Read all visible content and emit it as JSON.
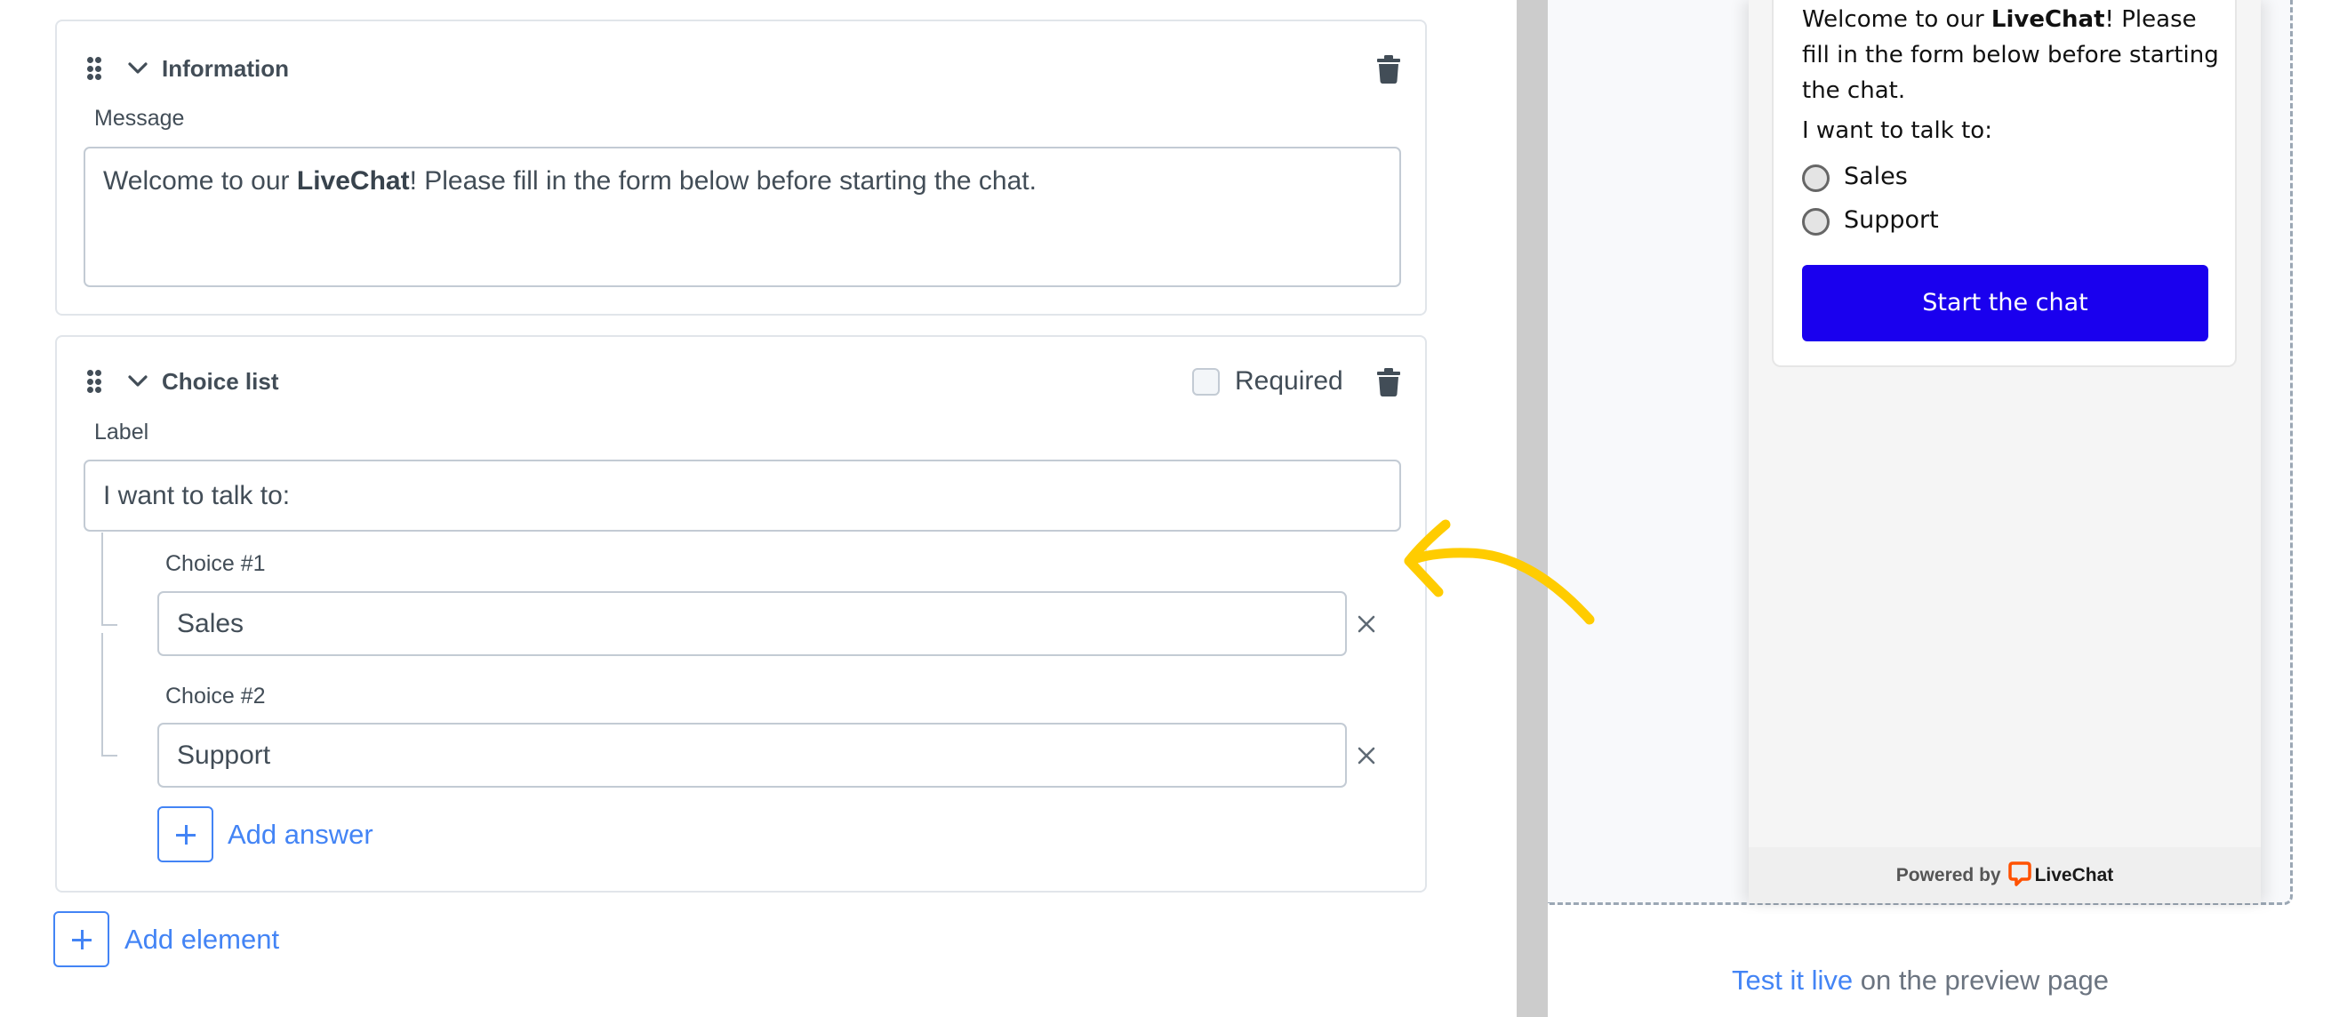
{
  "editor": {
    "information_card": {
      "title": "Information",
      "message_label": "Message",
      "message_parts": {
        "before": "Welcome to our ",
        "bold": "LiveChat",
        "after": "! Please fill in the form below before starting the chat."
      }
    },
    "choice_card": {
      "title": "Choice list",
      "required_label": "Required",
      "required_checked": false,
      "label_field_label": "Label",
      "label_value": "I want to talk to:",
      "choices": [
        {
          "label": "Choice #1",
          "value": "Sales"
        },
        {
          "label": "Choice #2",
          "value": "Support"
        }
      ],
      "add_answer_label": "Add answer"
    },
    "add_element_label": "Add element"
  },
  "preview": {
    "message_parts": {
      "before": "Welcome to our ",
      "bold": "LiveChat",
      "after": "! Please fill in the form below before starting the chat."
    },
    "question": "I want to talk to:",
    "options": [
      "Sales",
      "Support"
    ],
    "start_button": "Start the chat",
    "footer": {
      "powered_by": "Powered by",
      "brand": "LiveChat"
    },
    "test_live": {
      "link": "Test it live",
      "rest": " on the preview page"
    }
  },
  "colors": {
    "accent_link": "#4384f5",
    "start_button": "#1a00ee",
    "brand_orange": "#ff5100",
    "annotation_arrow": "#ffcc00"
  },
  "icons": {
    "drag": "drag-handle-icon",
    "collapse": "chevron-down-icon",
    "delete": "trash-icon",
    "remove": "close-icon",
    "add": "plus-icon",
    "logo": "livechat-logo-icon"
  }
}
